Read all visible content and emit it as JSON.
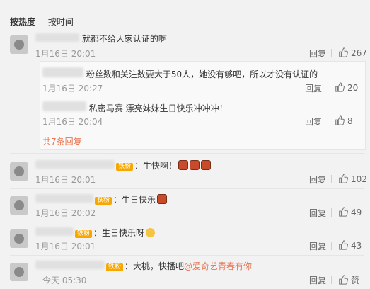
{
  "tabs": {
    "hot": "按热度",
    "time": "按时间"
  },
  "comments": [
    {
      "text": "就都不给人家认证的啊",
      "time": "1月16日 20:01",
      "reply_label": "回复",
      "likes": "267",
      "replies": [
        {
          "text": "粉丝数和关注数要大于50人，她没有够吧，所以才没有认证的",
          "time": "1月16日 20:27",
          "reply_label": "回复",
          "likes": "20"
        },
        {
          "text": "私密马赛 漂亮妹妹生日快乐冲冲冲！",
          "time": "1月16日 20:04",
          "reply_label": "回复",
          "likes": "8"
        }
      ],
      "more_replies": "共7条回复"
    },
    {
      "badge": "铁粉",
      "text": "：生快啊！",
      "time": "1月16日 20:01",
      "reply_label": "回复",
      "likes": "102"
    },
    {
      "badge": "铁粉",
      "text": "：生日快乐",
      "time": "1月16日 20:02",
      "reply_label": "回复",
      "likes": "49"
    },
    {
      "badge": "铁粉",
      "text": "：生日快乐呀",
      "time": "1月16日 20:01",
      "reply_label": "回复",
      "likes": "43"
    },
    {
      "badge": "铁粉",
      "text": "：大桃，快播吧",
      "mention": "@爱奇艺青春有你",
      "time": "今天 05:30",
      "reply_label": "回复",
      "likes": "赞"
    }
  ]
}
